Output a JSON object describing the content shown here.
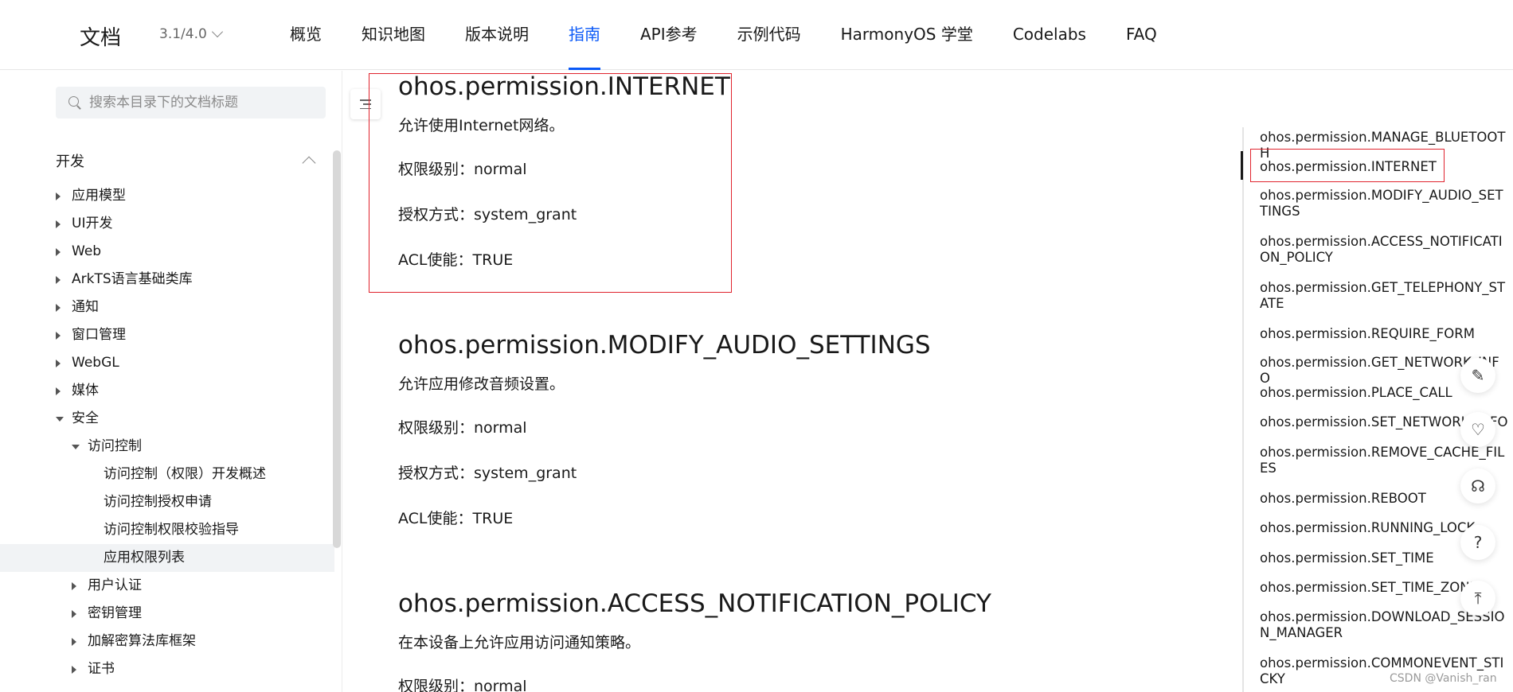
{
  "header": {
    "brand": "文档",
    "version": "3.1/4.0",
    "nav": [
      {
        "label": "概览",
        "active": false
      },
      {
        "label": "知识地图",
        "active": false
      },
      {
        "label": "版本说明",
        "active": false
      },
      {
        "label": "指南",
        "active": true
      },
      {
        "label": "API参考",
        "active": false
      },
      {
        "label": "示例代码",
        "active": false
      },
      {
        "label": "HarmonyOS 学堂",
        "active": false
      },
      {
        "label": "Codelabs",
        "active": false
      },
      {
        "label": "FAQ",
        "active": false
      }
    ]
  },
  "sidebar": {
    "search_placeholder": "搜索本目录下的文档标题",
    "section": "开发",
    "items": [
      {
        "label": "应用模型"
      },
      {
        "label": "UI开发"
      },
      {
        "label": "Web"
      },
      {
        "label": "ArkTS语言基础类库"
      },
      {
        "label": "通知"
      },
      {
        "label": "窗口管理"
      },
      {
        "label": "WebGL"
      },
      {
        "label": "媒体"
      },
      {
        "label": "安全"
      },
      {
        "label": "访问控制"
      },
      {
        "label": "访问控制（权限）开发概述"
      },
      {
        "label": "访问控制授权申请"
      },
      {
        "label": "访问控制权限校验指导"
      },
      {
        "label": "应用权限列表"
      },
      {
        "label": "用户认证"
      },
      {
        "label": "密钥管理"
      },
      {
        "label": "加解密算法库框架"
      },
      {
        "label": "证书"
      }
    ]
  },
  "content": {
    "permissions": [
      {
        "title": "ohos.permission.INTERNET",
        "desc": "允许使用Internet网络。",
        "level": "权限级别：normal",
        "grant": "授权方式：system_grant",
        "acl": "ACL使能：TRUE"
      },
      {
        "title": "ohos.permission.MODIFY_AUDIO_SETTINGS",
        "desc": "允许应用修改音频设置。",
        "level": "权限级别：normal",
        "grant": "授权方式：system_grant",
        "acl": "ACL使能：TRUE"
      },
      {
        "title": "ohos.permission.ACCESS_NOTIFICATION_POLICY",
        "desc": "在本设备上允许应用访问通知策略。",
        "level": "权限级别：normal"
      }
    ]
  },
  "toc": {
    "items": [
      "ohos.permission.MANAGE_BLUETOOTH",
      "ohos.permission.INTERNET",
      "ohos.permission.MODIFY_AUDIO_SETTINGS",
      "ohos.permission.ACCESS_NOTIFICATION_POLICY",
      "ohos.permission.GET_TELEPHONY_STATE",
      "ohos.permission.REQUIRE_FORM",
      "ohos.permission.GET_NETWORK_INFO",
      "ohos.permission.PLACE_CALL",
      "ohos.permission.SET_NETWORK_INFO",
      "ohos.permission.REMOVE_CACHE_FILES",
      "ohos.permission.REBOOT",
      "ohos.permission.RUNNING_LOCK",
      "ohos.permission.SET_TIME",
      "ohos.permission.SET_TIME_ZONE",
      "ohos.permission.DOWNLOAD_SESSION_MANAGER",
      "ohos.permission.COMMONEVENT_STICKY"
    ]
  },
  "watermark": "CSDN @Vanish_ran",
  "colors": {
    "accent": "#0a59f7",
    "highlight_border": "#e0242e"
  }
}
